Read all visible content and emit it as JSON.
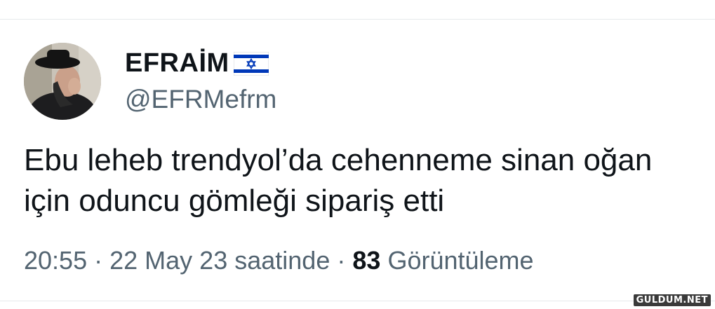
{
  "author": {
    "display_name": "EFRAİM",
    "flag_icon": "israel-flag-icon",
    "handle": "@EFRMefrm",
    "avatar_icon": "profile-avatar"
  },
  "tweet": {
    "text": "Ebu leheb trendyol’da cehenneme sinan oğan için oduncu gömleği sipariş etti",
    "time": "20:55",
    "separator_1": "·",
    "date_text": "22 May 23 saatinde",
    "separator_2": "·",
    "view_count": "83",
    "view_label": "Görüntüleme"
  },
  "watermark": "GULDUM.NET",
  "colors": {
    "text_primary": "#0f1419",
    "text_secondary": "#536471",
    "divider": "#e6e9ec",
    "flag_blue": "#0038b8"
  }
}
